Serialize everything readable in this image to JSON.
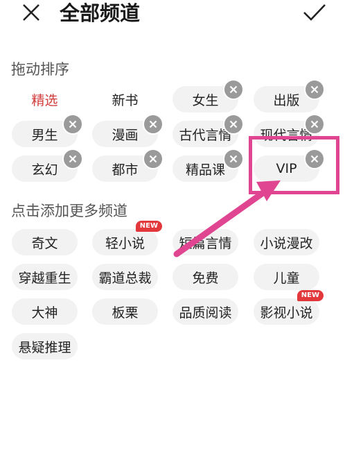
{
  "header": {
    "title": "全部频道",
    "close_icon": "close-icon",
    "check_icon": "check-icon"
  },
  "sections": [
    {
      "title": "拖动排序"
    },
    {
      "title": "点击添加更多频道"
    }
  ],
  "sort_chips": [
    {
      "label": "精选",
      "selected": true,
      "removable": false
    },
    {
      "label": "新书",
      "selected": false,
      "removable": false
    },
    {
      "label": "女生",
      "removable": true
    },
    {
      "label": "出版",
      "removable": true
    },
    {
      "label": "男生",
      "removable": true
    },
    {
      "label": "漫画",
      "removable": true
    },
    {
      "label": "古代言情",
      "removable": true
    },
    {
      "label": "现代言情",
      "removable": true
    },
    {
      "label": "玄幻",
      "removable": true
    },
    {
      "label": "都市",
      "removable": true
    },
    {
      "label": "精品课",
      "removable": true
    },
    {
      "label": "VIP",
      "removable": true
    }
  ],
  "add_chips": [
    {
      "label": "奇文"
    },
    {
      "label": "轻小说",
      "badge": "NEW"
    },
    {
      "label": "短篇言情"
    },
    {
      "label": "小说漫改"
    },
    {
      "label": "穿越重生"
    },
    {
      "label": "霸道总裁"
    },
    {
      "label": "免费"
    },
    {
      "label": "儿童"
    },
    {
      "label": "大神"
    },
    {
      "label": "板栗"
    },
    {
      "label": "品质阅读"
    },
    {
      "label": "影视小说",
      "badge": "NEW"
    },
    {
      "label": "悬疑推理"
    }
  ],
  "colors": {
    "accent_selected": "#d23a3a",
    "annotation": "#e04592",
    "badge": "#e3383b",
    "chip_bg": "#f2f2f2"
  }
}
